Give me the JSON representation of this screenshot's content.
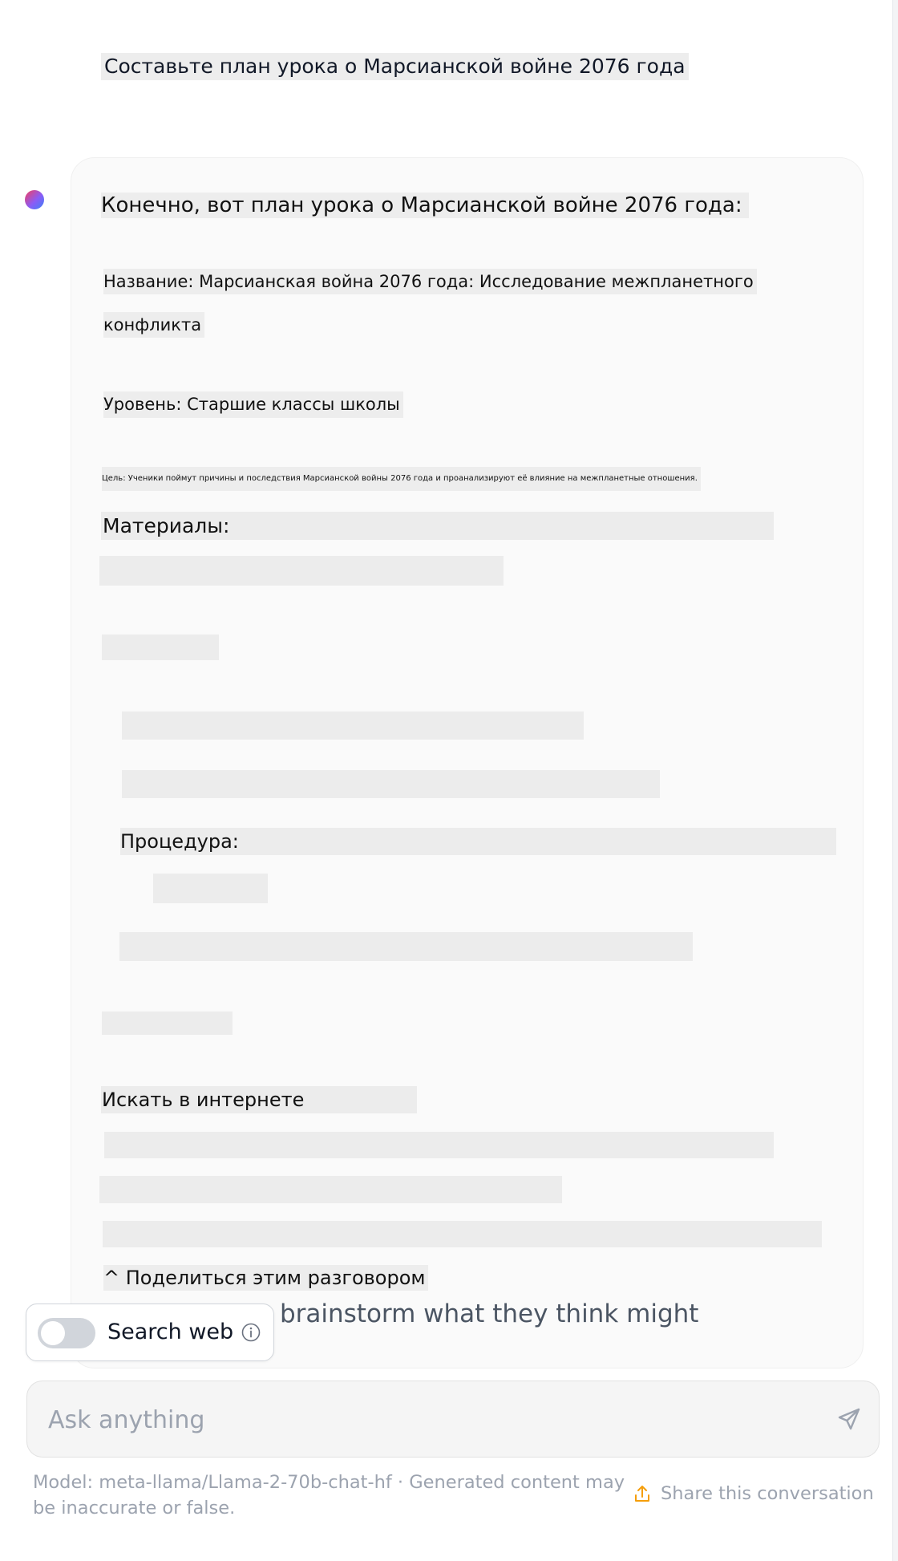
{
  "conversation": {
    "user_message": "Составьте план урока о Марсианской войне 2076 года",
    "assistant": {
      "intro": "Конечно, вот план урока о Марсианской войне 2076 года:",
      "title_line1": "Название: Марсианская война 2076 года: Исследование межпланетного",
      "title_line2": "конфликта",
      "level": "Уровень: Старшие классы школы",
      "goal": "Цель: Ученики поймут причины и последствия Марсианской войны 2076 года и проанализируют её влияние на межпланетные отношения.",
      "materials_heading": "Материалы:",
      "procedure_heading": "Процедура:",
      "search_heading": "Искать в интернете",
      "share_heading": "^ Поделиться этим разговором",
      "underlying_text": "s to brainstorm what they think might"
    }
  },
  "search_web": {
    "label": "Search web",
    "enabled": false
  },
  "input": {
    "placeholder": "Ask anything"
  },
  "footer": {
    "model_notice": "Model: meta-llama/Llama-2-70b-chat-hf · Generated content may be inaccurate or false.",
    "share_label": "Share this conversation"
  },
  "colors": {
    "accent_share_icon": "#f59e0b",
    "muted_text": "#9ca3af",
    "highlight_bar": "#ececec"
  }
}
